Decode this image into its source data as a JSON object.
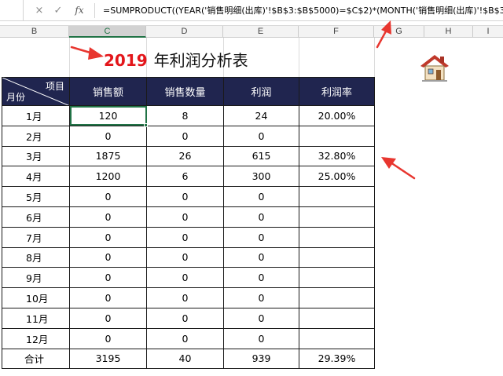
{
  "formula_bar": {
    "cancel_icon": "×",
    "confirm_icon": "✓",
    "fx_label": "fx",
    "formula": "=SUMPRODUCT((YEAR('销售明细(出库)'!$B$3:$B$5000)=$C$2)*(MONTH('销售明细(出库)'!$B$3"
  },
  "columns": [
    "B",
    "C",
    "D",
    "E",
    "F",
    "G",
    "H",
    "I"
  ],
  "active_column": "C",
  "title": {
    "year": "2019",
    "text": "年利润分析表"
  },
  "table": {
    "corner_top": "项目",
    "corner_bottom": "月份",
    "headers": [
      "销售额",
      "销售数量",
      "利润",
      "利润率"
    ],
    "rows": [
      {
        "month": "1月",
        "sales": "120",
        "qty": "8",
        "profit": "24",
        "rate": "20.00%"
      },
      {
        "month": "2月",
        "sales": "0",
        "qty": "0",
        "profit": "0",
        "rate": ""
      },
      {
        "month": "3月",
        "sales": "1875",
        "qty": "26",
        "profit": "615",
        "rate": "32.80%"
      },
      {
        "month": "4月",
        "sales": "1200",
        "qty": "6",
        "profit": "300",
        "rate": "25.00%"
      },
      {
        "month": "5月",
        "sales": "0",
        "qty": "0",
        "profit": "0",
        "rate": ""
      },
      {
        "month": "6月",
        "sales": "0",
        "qty": "0",
        "profit": "0",
        "rate": ""
      },
      {
        "month": "7月",
        "sales": "0",
        "qty": "0",
        "profit": "0",
        "rate": ""
      },
      {
        "month": "8月",
        "sales": "0",
        "qty": "0",
        "profit": "0",
        "rate": ""
      },
      {
        "month": "9月",
        "sales": "0",
        "qty": "0",
        "profit": "0",
        "rate": ""
      },
      {
        "month": "10月",
        "sales": "0",
        "qty": "0",
        "profit": "0",
        "rate": ""
      },
      {
        "month": "11月",
        "sales": "0",
        "qty": "0",
        "profit": "0",
        "rate": ""
      },
      {
        "month": "12月",
        "sales": "0",
        "qty": "0",
        "profit": "0",
        "rate": ""
      }
    ],
    "total": {
      "month": "合计",
      "sales": "3195",
      "qty": "40",
      "profit": "939",
      "rate": "29.39%"
    }
  },
  "colors": {
    "header_bg": "#20254f",
    "year_red": "#e3161b",
    "arrow_red": "#e8362f",
    "selection_green": "#217346"
  },
  "icons": {
    "home": "house-icon"
  }
}
